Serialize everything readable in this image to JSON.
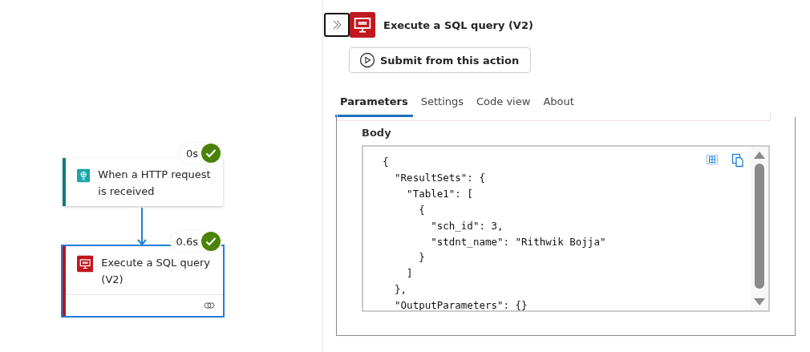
{
  "flow": {
    "nodes": [
      {
        "kind": "trigger",
        "title": "When a HTTP request is received",
        "duration": "0s",
        "selected": false
      },
      {
        "kind": "sql",
        "title": "Execute a SQL query (V2)",
        "duration": "0.6s",
        "selected": true
      }
    ]
  },
  "panel": {
    "title": "Execute a SQL query (V2)",
    "submit_button": "Submit from this action",
    "tabs": [
      {
        "label": "Parameters",
        "selected": true
      },
      {
        "label": "Settings",
        "selected": false
      },
      {
        "label": "Code view",
        "selected": false
      },
      {
        "label": "About",
        "selected": false
      }
    ],
    "body_label": "Body",
    "body_lines": [
      "{",
      "  \"ResultSets\": {",
      "    \"Table1\": [",
      "      {",
      "        \"sch_id\": 3,",
      "        \"stdnt_name\": \"Rithwik Bojja\"",
      "      }",
      "    ]",
      "  },",
      "  \"OutputParameters\": {}"
    ]
  }
}
